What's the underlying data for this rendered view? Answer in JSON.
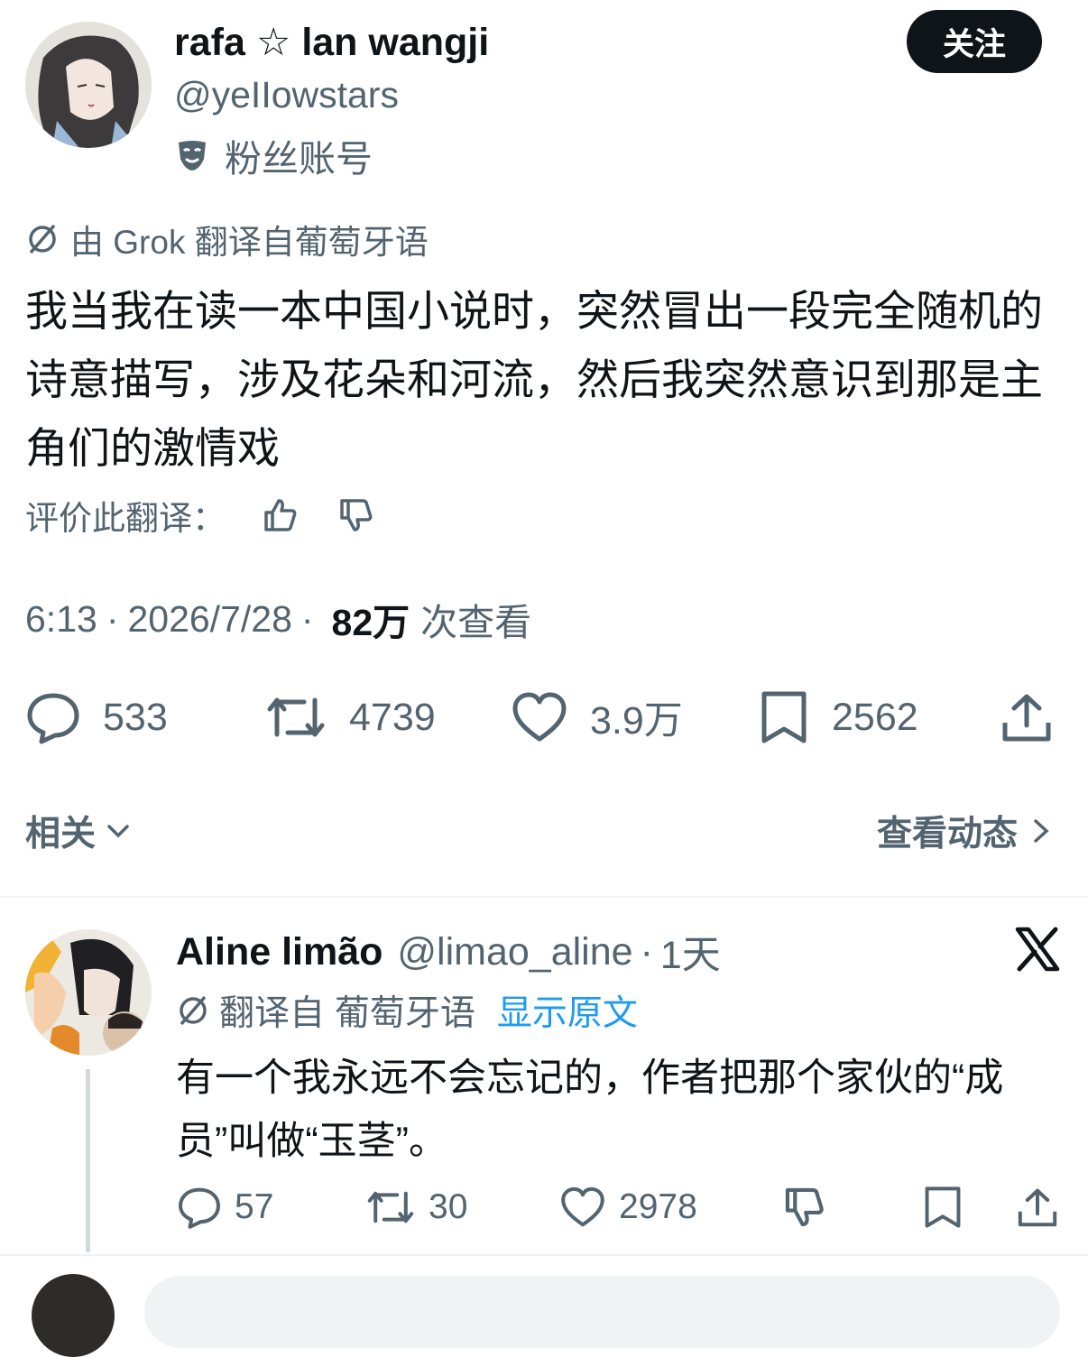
{
  "main_tweet": {
    "display_name": "rafa ☆ lan wangji",
    "handle": "@yeIIowstars",
    "parody_label": "粉丝账号",
    "follow_label": "关注",
    "translated_note": "由 Grok 翻译自葡萄牙语",
    "text": "我当我在读一本中国小说时，突然冒出一段完全随机的诗意描写，涉及花朵和河流，然后我突然意识到那是主角们的激情戏",
    "rate_translation_label": "评价此翻译：",
    "time": "6:13",
    "date": "2026/7/28",
    "separator": "·",
    "views_count": "82万",
    "views_label": "次查看",
    "replies": "533",
    "reposts": "4739",
    "likes": "3.9万",
    "bookmarks": "2562"
  },
  "related": {
    "label": "相关",
    "view_activity": "查看动态"
  },
  "reply": {
    "display_name": "Aline limão",
    "handle": "@limao_aline",
    "separator": "·",
    "time_ago": "1天",
    "translated_from": "翻译自 葡萄牙语",
    "show_original": "显示原文",
    "text": "有一个我永远不会忘记的，作者把那个家伙的“成员”叫做“玉茎”。",
    "replies": "57",
    "reposts": "30",
    "likes": "2978"
  },
  "colors": {
    "text_primary": "#0f1419",
    "text_secondary": "#536471",
    "link": "#1d9bf0",
    "follow_button_bg": "#0f1419",
    "divider": "#eff3f4"
  },
  "icons": [
    "reply-icon",
    "repost-icon",
    "like-icon",
    "bookmark-icon",
    "share-icon",
    "thumbs-up-icon",
    "thumbs-down-icon",
    "translate-icon",
    "parody-mask-icon",
    "chevron-down-icon",
    "chevron-right-icon",
    "x-logo-icon"
  ]
}
